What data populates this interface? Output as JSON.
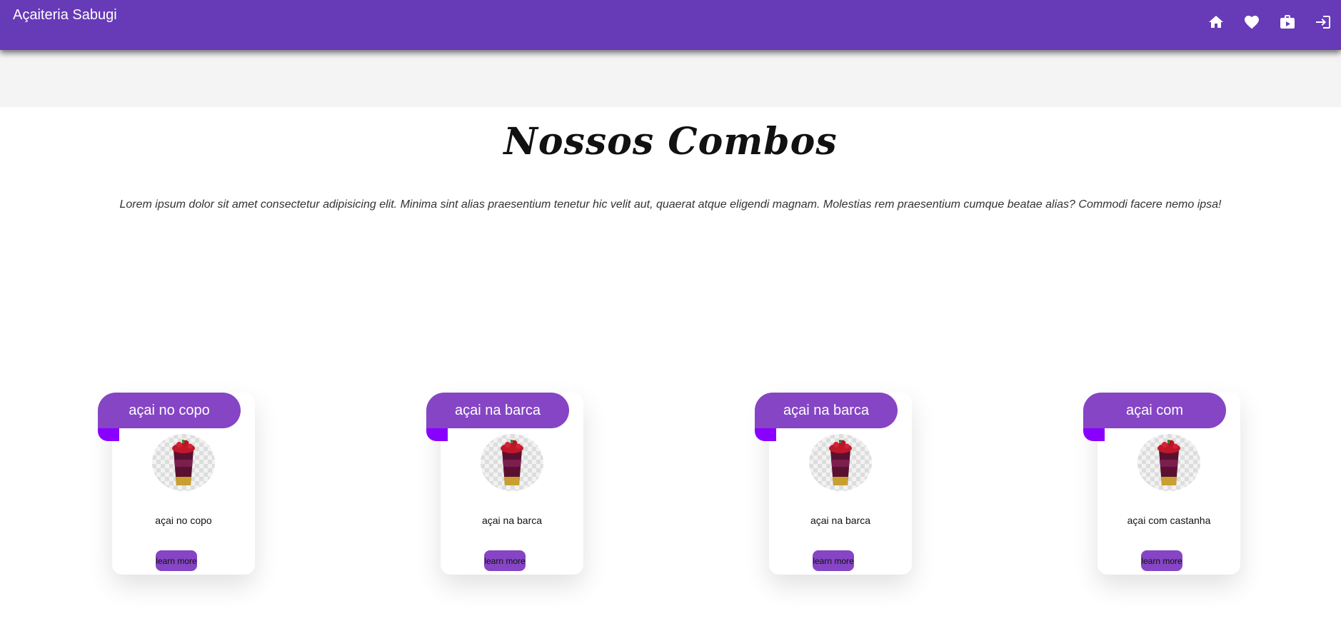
{
  "app": {
    "title": "Açaiteria Sabugi",
    "nav": [
      {
        "icon": "home-icon"
      },
      {
        "icon": "heart-icon"
      },
      {
        "icon": "briefcase-icon"
      },
      {
        "icon": "login-icon"
      }
    ]
  },
  "colors": {
    "appbar": "#673ab7",
    "ribbon": "#8545c4",
    "ribbon_fold": "#8a00ff",
    "button": "#8545c4"
  },
  "section": {
    "heading": "Nossos Combos",
    "text": "Lorem ipsum dolor sit amet consectetur adipisicing elit. Minima sint alias praesentium tenetur hic velit aut, quaerat atque eligendi magnam. Molestias rem praesentium cumque beatae alias? Commodi facere nemo ipsa!"
  },
  "cards": [
    {
      "title": "açai no copo",
      "description": "açai no copo",
      "button": "learn more",
      "image_icon": "acai-cup-icon"
    },
    {
      "title": "açai na barca",
      "description": "açai na barca",
      "button": "learn more",
      "image_icon": "acai-cup-icon"
    },
    {
      "title": "açai na barca",
      "description": "açai na barca",
      "button": "learn more",
      "image_icon": "acai-cup-icon"
    },
    {
      "title": "açai com",
      "description": "açai com castanha",
      "button": "learn more",
      "image_icon": "acai-cup-icon"
    }
  ]
}
